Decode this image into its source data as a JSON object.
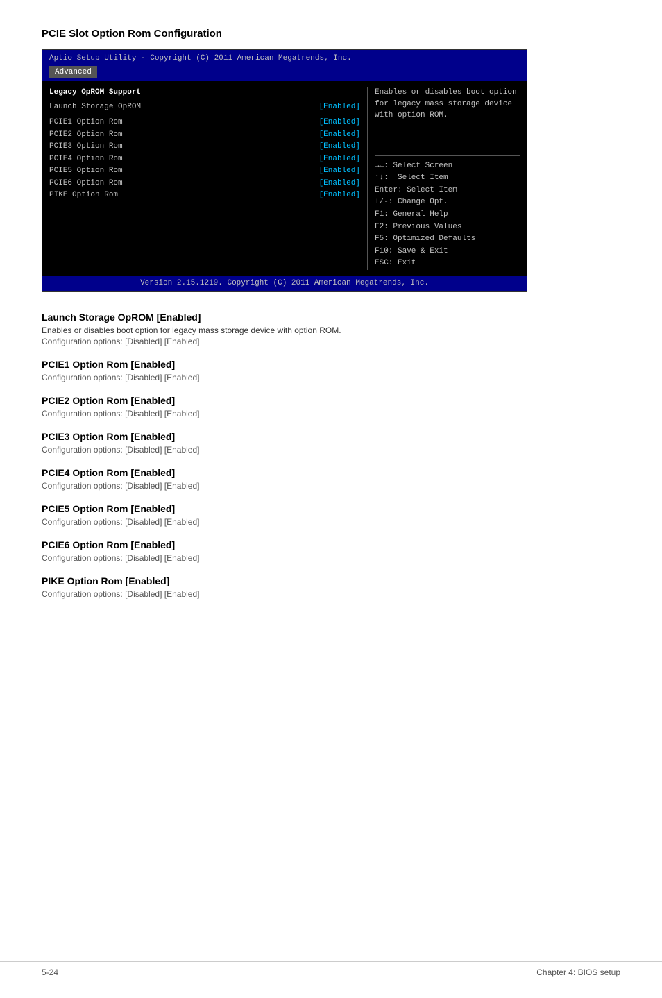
{
  "page": {
    "title": "PCIE Slot Option Rom Configuration"
  },
  "bios": {
    "header_text": "Aptio Setup Utility - Copyright (C) 2011 American Megatrends, Inc.",
    "tab_label": "Advanced",
    "footer_text": "Version 2.15.1219. Copyright (C) 2011 American Megatrends, Inc.",
    "left": {
      "section_label": "Legacy OpROM Support",
      "rows": [
        {
          "label": "Launch Storage OpROM",
          "value": "[Enabled]"
        },
        {
          "label": "",
          "value": ""
        },
        {
          "label": "PCIE1 Option Rom",
          "value": "[Enabled]"
        },
        {
          "label": "PCIE2 Option Rom",
          "value": "[Enabled]"
        },
        {
          "label": "PCIE3 Option Rom",
          "value": "[Enabled]"
        },
        {
          "label": "PCIE4 Option Rom",
          "value": "[Enabled]"
        },
        {
          "label": "PCIE5 Option Rom",
          "value": "[Enabled]"
        },
        {
          "label": "PCIE6 Option Rom",
          "value": "[Enabled]"
        },
        {
          "label": "PIKE Option Rom",
          "value": "[Enabled]"
        }
      ]
    },
    "right": {
      "help_text": "Enables or disables boot option for legacy mass storage device with option ROM.",
      "keys": [
        "→←: Select Screen",
        "↑↓:  Select Item",
        "Enter: Select Item",
        "+/-: Change Opt.",
        "F1: General Help",
        "F2: Previous Values",
        "F5: Optimized Defaults",
        "F10: Save & Exit",
        "ESC: Exit"
      ]
    }
  },
  "sections": [
    {
      "id": "launch-storage",
      "heading": "Launch Storage OpROM [Enabled]",
      "desc": "Enables or disables boot option for legacy mass storage device with option ROM.",
      "config": "Configuration options: [Disabled] [Enabled]"
    },
    {
      "id": "pcie1",
      "heading": "PCIE1 Option Rom [Enabled]",
      "desc": "",
      "config": "Configuration options: [Disabled] [Enabled]"
    },
    {
      "id": "pcie2",
      "heading": "PCIE2 Option Rom [Enabled]",
      "desc": "",
      "config": "Configuration options: [Disabled] [Enabled]"
    },
    {
      "id": "pcie3",
      "heading": "PCIE3 Option Rom [Enabled]",
      "desc": "",
      "config": "Configuration options: [Disabled] [Enabled]"
    },
    {
      "id": "pcie4",
      "heading": "PCIE4 Option Rom [Enabled]",
      "desc": "",
      "config": "Configuration options: [Disabled] [Enabled]"
    },
    {
      "id": "pcie5",
      "heading": "PCIE5 Option Rom [Enabled]",
      "desc": "",
      "config": "Configuration options: [Disabled] [Enabled]"
    },
    {
      "id": "pcie6",
      "heading": "PCIE6 Option Rom [Enabled]",
      "desc": "",
      "config": "Configuration options: [Disabled] [Enabled]"
    },
    {
      "id": "pike",
      "heading": "PIKE Option Rom [Enabled]",
      "desc": "",
      "config": "Configuration options: [Disabled] [Enabled]"
    }
  ],
  "footer": {
    "left": "5-24",
    "right": "Chapter 4: BIOS setup"
  }
}
